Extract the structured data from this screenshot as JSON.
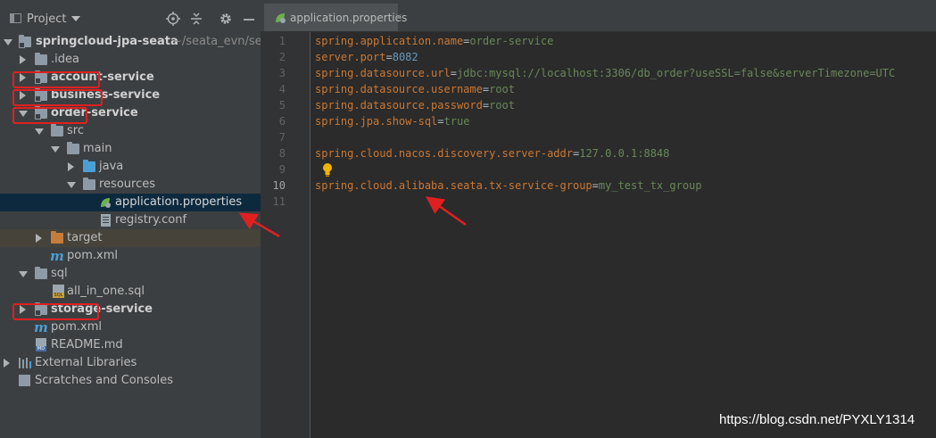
{
  "colors": {
    "sidebar_bg": "#3c3f41",
    "editor_bg": "#2b2b2b",
    "selection_bg": "#0d293e",
    "key_color": "#cc7832",
    "value_color": "#6a8759",
    "number_color": "#6897bb",
    "annotation_red": "#e02020"
  },
  "sidebar": {
    "title": "Project",
    "toolbar_icons": [
      "locate-icon",
      "collapse-all-icon",
      "gear-icon",
      "hide-icon"
    ],
    "tree": [
      {
        "label": "springcloud-jpa-seata",
        "path": "~/seata_evn/seata",
        "icon": "module-folder-icon",
        "expanded": true
      },
      {
        "label": ".idea",
        "icon": "folder-icon",
        "expanded": false
      },
      {
        "label": "account-service",
        "icon": "module-folder-icon",
        "expanded": false
      },
      {
        "label": "business-service",
        "icon": "module-folder-icon",
        "expanded": false
      },
      {
        "label": "order-service",
        "icon": "module-folder-icon",
        "expanded": true
      },
      {
        "label": "src",
        "icon": "folder-icon",
        "expanded": true
      },
      {
        "label": "main",
        "icon": "folder-icon",
        "expanded": true
      },
      {
        "label": "java",
        "icon": "java-folder-icon",
        "expanded": false
      },
      {
        "label": "resources",
        "icon": "resources-folder-icon",
        "expanded": true
      },
      {
        "label": "application.properties",
        "icon": "spring-leaf-icon",
        "selected": true
      },
      {
        "label": "registry.conf",
        "icon": "text-file-icon"
      },
      {
        "label": "target",
        "icon": "excluded-folder-icon",
        "expanded": false
      },
      {
        "label": "pom.xml",
        "icon": "maven-icon"
      },
      {
        "label": "sql",
        "icon": "folder-icon",
        "expanded": true
      },
      {
        "label": "all_in_one.sql",
        "icon": "sql-file-icon"
      },
      {
        "label": "storage-service",
        "icon": "module-folder-icon",
        "expanded": false
      },
      {
        "label": "pom.xml",
        "icon": "maven-icon"
      },
      {
        "label": "README.md",
        "icon": "markdown-file-icon"
      },
      {
        "label": "External Libraries",
        "icon": "libraries-icon",
        "expanded": false
      },
      {
        "label": "Scratches and Consoles",
        "icon": "scratches-icon"
      }
    ]
  },
  "editor": {
    "tab": {
      "label": "application.properties",
      "close": "×"
    },
    "lines": [
      {
        "num": "1",
        "key": "spring.application.name",
        "eq": "=",
        "val": "order-service"
      },
      {
        "num": "2",
        "key": "server.port",
        "eq": "=",
        "val": "8082"
      },
      {
        "num": "3",
        "key": "spring.datasource.url",
        "eq": "=",
        "val": "jdbc:mysql://localhost:3306/db_order?useSSL=false&serverTimezone=UTC"
      },
      {
        "num": "4",
        "key": "spring.datasource.username",
        "eq": "=",
        "val": "root"
      },
      {
        "num": "5",
        "key": "spring.datasource.password",
        "eq": "=",
        "val": "root"
      },
      {
        "num": "6",
        "key": "spring.jpa.show-sql",
        "eq": "=",
        "val": "true"
      },
      {
        "num": "7",
        "key": "",
        "eq": "",
        "val": ""
      },
      {
        "num": "8",
        "key": "spring.cloud.nacos.discovery.server-addr",
        "eq": "=",
        "val": "127.0.0.1:8848"
      },
      {
        "num": "9",
        "key": "",
        "eq": "",
        "val": ""
      },
      {
        "num": "10",
        "key": "spring.cloud.alibaba.seata.tx-service-group",
        "eq": "=",
        "val": "my_test_tx_group"
      },
      {
        "num": "11",
        "key": "",
        "eq": "",
        "val": ""
      }
    ]
  },
  "watermark": "https://blog.csdn.net/PYXLY1314"
}
